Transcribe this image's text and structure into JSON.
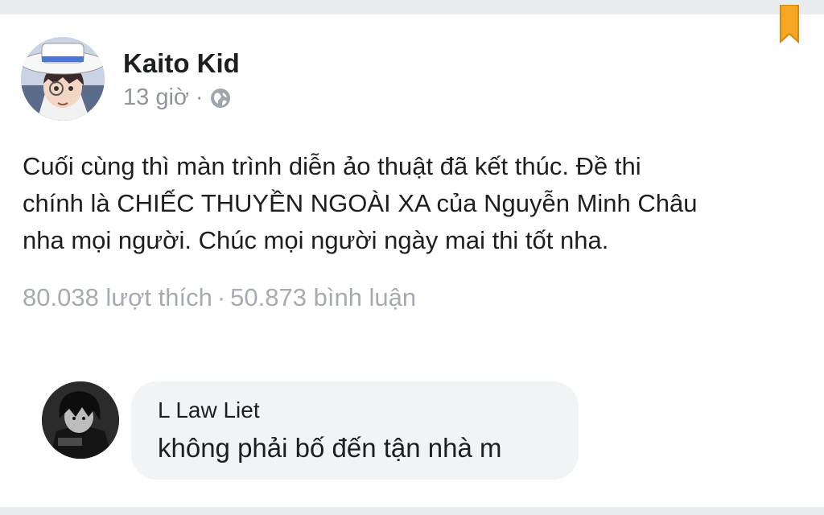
{
  "post": {
    "author": "Kaito Kid",
    "time": "13 giờ",
    "meta_separator": "·",
    "privacy_icon": "globe-icon",
    "bookmark_icon": "bookmark-icon",
    "text_lines": [
      "Cuối cùng thì màn trình diễn ảo thuật đã kết thúc. Đề thi",
      "chính là CHIẾC THUYỀN NGOÀI XA của Nguyễn Minh Châu",
      "nha mọi người. Chúc mọi người ngày mai thi tốt nha."
    ],
    "likes": "80.038 lượt thích",
    "stats_separator": "·",
    "comments_count": "50.873 bình luận"
  },
  "comment": {
    "author": "L Law Liet",
    "text": "không phải bố đến tận nhà m"
  },
  "colors": {
    "bookmark": "#f5a623",
    "meta_text": "#90949c",
    "stats_text": "#a7aab1",
    "bubble_bg": "#f2f3f5",
    "page_bg": "#e9ebee"
  }
}
